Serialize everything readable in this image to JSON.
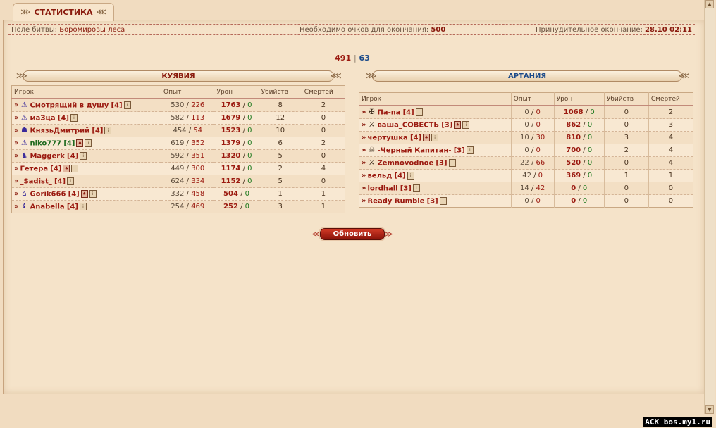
{
  "tab": {
    "title": "СТАТИСТИКА"
  },
  "info": {
    "battlefield_label": "Поле битвы:",
    "battlefield_value": "Боромировы леса",
    "points_label": "Необходимо очков для окончания:",
    "points_value": "500",
    "forced_end_label": "Принудительное окончание:",
    "forced_end_value": "28.10 02:11"
  },
  "score": {
    "left": "491",
    "sep": "|",
    "right": "63"
  },
  "teams": [
    {
      "name": "КУЯВИЯ",
      "color": "#8a1b0e",
      "headers": [
        "Игрок",
        "Опыт",
        "Урон",
        "Убийств",
        "Смертей"
      ],
      "rows": [
        {
          "icon": "triangle-warn-icon",
          "glyph": "⚠",
          "name": "Смотрящий в душу",
          "level": "[4]",
          "extra": false,
          "exp_a": "530",
          "exp_b": "226",
          "dmg_a": "1763",
          "dmg_b": "0",
          "kills": "8",
          "deaths": "2"
        },
        {
          "icon": "triangle-warn-icon",
          "glyph": "⚠",
          "name": "маЗца",
          "level": "[4]",
          "extra": false,
          "exp_a": "582",
          "exp_b": "113",
          "dmg_a": "1679",
          "dmg_b": "0",
          "kills": "12",
          "deaths": "0"
        },
        {
          "icon": "helmet-icon",
          "glyph": "☗",
          "name": "КнязьДмитрий",
          "level": "[4]",
          "extra": false,
          "exp_a": "454",
          "exp_b": "54",
          "dmg_a": "1523",
          "dmg_b": "0",
          "kills": "10",
          "deaths": "0"
        },
        {
          "icon": "triangle-warn-icon",
          "glyph": "⚠",
          "name": "niko777",
          "level": "[4]",
          "extra": true,
          "exp_a": "619",
          "exp_b": "352",
          "dmg_a": "1379",
          "dmg_b": "0",
          "kills": "6",
          "deaths": "2"
        },
        {
          "icon": "wolf-icon",
          "glyph": "♞",
          "name": "Maggerk",
          "level": "[4]",
          "extra": false,
          "exp_a": "592",
          "exp_b": "351",
          "dmg_a": "1320",
          "dmg_b": "0",
          "kills": "5",
          "deaths": "0"
        },
        {
          "icon": "none",
          "glyph": "",
          "name": "Гетера",
          "level": "[4]",
          "extra": true,
          "exp_a": "449",
          "exp_b": "300",
          "dmg_a": "1174",
          "dmg_b": "0",
          "kills": "2",
          "deaths": "4"
        },
        {
          "icon": "none",
          "glyph": "",
          "name": "_Sadist_",
          "level": "[4]",
          "extra": false,
          "exp_a": "624",
          "exp_b": "334",
          "dmg_a": "1152",
          "dmg_b": "0",
          "kills": "5",
          "deaths": "0"
        },
        {
          "icon": "house-icon",
          "glyph": "⌂",
          "name": "Gorik666",
          "level": "[4]",
          "extra": true,
          "exp_a": "332",
          "exp_b": "458",
          "dmg_a": "504",
          "dmg_b": "0",
          "kills": "1",
          "deaths": "1"
        },
        {
          "icon": "cat-icon",
          "glyph": "♝",
          "name": "Anabella",
          "level": "[4]",
          "extra": false,
          "exp_a": "254",
          "exp_b": "469",
          "dmg_a": "252",
          "dmg_b": "0",
          "kills": "3",
          "deaths": "1"
        }
      ]
    },
    {
      "name": "АРТАНИЯ",
      "color": "#1a4a8a",
      "headers": [
        "Игрок",
        "Опыт",
        "Урон",
        "Убийств",
        "Смертей"
      ],
      "rows": [
        {
          "icon": "cross-swords-icon",
          "glyph": "✠",
          "name": "Па-па",
          "level": "[4]",
          "extra": false,
          "exp_a": "0",
          "exp_b": "0",
          "dmg_a": "1068",
          "dmg_b": "0",
          "kills": "0",
          "deaths": "2"
        },
        {
          "icon": "sword-icon",
          "glyph": "⚔",
          "name": "ваша_СОВЕСТЬ",
          "level": "[3]",
          "extra": true,
          "exp_a": "0",
          "exp_b": "0",
          "dmg_a": "862",
          "dmg_b": "0",
          "kills": "0",
          "deaths": "3"
        },
        {
          "icon": "none",
          "glyph": "",
          "name": "чертушка",
          "level": "[4]",
          "extra": true,
          "exp_a": "10",
          "exp_b": "30",
          "dmg_a": "810",
          "dmg_b": "0",
          "kills": "3",
          "deaths": "4"
        },
        {
          "icon": "skull-icon",
          "glyph": "☠",
          "name": "-Черный Капитан-",
          "level": "[3]",
          "extra": false,
          "exp_a": "0",
          "exp_b": "0",
          "dmg_a": "700",
          "dmg_b": "0",
          "kills": "2",
          "deaths": "4"
        },
        {
          "icon": "sword-icon",
          "glyph": "⚔",
          "name": "Zemnovodnoe",
          "level": "[3]",
          "extra": false,
          "exp_a": "22",
          "exp_b": "66",
          "dmg_a": "520",
          "dmg_b": "0",
          "kills": "0",
          "deaths": "4"
        },
        {
          "icon": "none",
          "glyph": "",
          "name": "вельд",
          "level": "[4]",
          "extra": false,
          "exp_a": "42",
          "exp_b": "0",
          "dmg_a": "369",
          "dmg_b": "0",
          "kills": "1",
          "deaths": "1"
        },
        {
          "icon": "none",
          "glyph": "",
          "name": "lordhall",
          "level": "[3]",
          "extra": false,
          "exp_a": "14",
          "exp_b": "42",
          "dmg_a": "0",
          "dmg_b": "0",
          "kills": "0",
          "deaths": "0"
        },
        {
          "icon": "none",
          "glyph": "",
          "name": "Ready Rumble",
          "level": "[3]",
          "extra": false,
          "exp_a": "0",
          "exp_b": "0",
          "dmg_a": "0",
          "dmg_b": "0",
          "kills": "0",
          "deaths": "0"
        }
      ]
    }
  ],
  "button": {
    "label": "Обновить"
  },
  "brand": "ACK bos.my1.ru"
}
